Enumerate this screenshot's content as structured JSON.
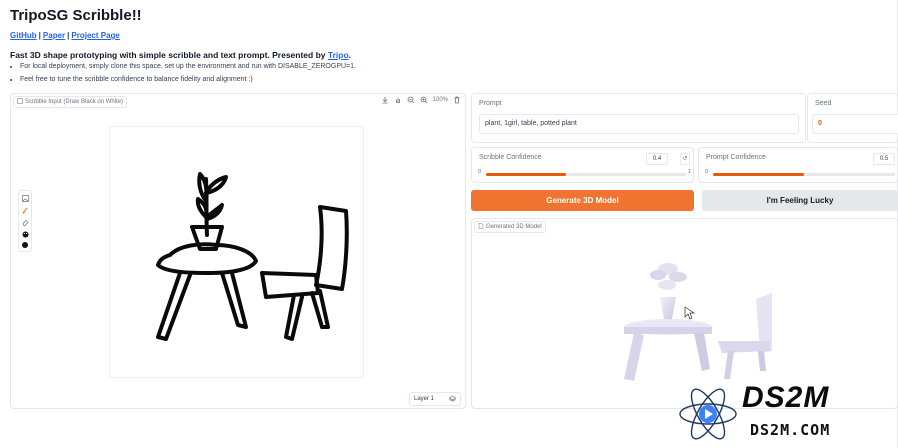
{
  "app": {
    "title": "TripoSG Scribble!!",
    "links": [
      {
        "label": "GitHub"
      },
      {
        "label": "Paper"
      },
      {
        "label": "Project Page"
      }
    ],
    "separator": "|",
    "subtitle_prefix": "Fast 3D shape prototyping with simple scribble and text prompt. Presented by ",
    "subtitle_link": "Tripo",
    "subtitle_suffix": ".",
    "notes": [
      "For local deployment, simply clone this space, set up the environment and run with DISABLE_ZEROGPU=1.",
      "Feel free to tune the scribble confidence to balance fidelity and alignment :)"
    ]
  },
  "scribble": {
    "label": "Scribble Input (Draw Black on White)",
    "zoom": "100%",
    "layer": "Layer 1",
    "icons": [
      "download-icon",
      "pan-icon",
      "zoom-out-icon",
      "zoom-in-icon",
      "trash-icon"
    ],
    "side_tools": [
      "image-icon",
      "brush-icon",
      "eraser-icon",
      "palette-icon",
      "color-black"
    ]
  },
  "prompt": {
    "label": "Prompt",
    "value": "plant, 1girl, table, potted plant"
  },
  "seed": {
    "label": "Seed",
    "value": "0"
  },
  "scribble_confidence": {
    "label": "Scribble Confidence",
    "value": "0.4",
    "min": "0",
    "max": "1",
    "fraction": 0.4
  },
  "prompt_confidence": {
    "label": "Prompt Confidence",
    "value": "0.5",
    "min": "0",
    "fraction": 0.5
  },
  "buttons": {
    "generate": "Generate 3D Model",
    "lucky": "I'm Feeling Lucky"
  },
  "model_output": {
    "label": "Generated 3D Model"
  },
  "watermark": {
    "big": "DS2M",
    "small": "DS2M.COM"
  },
  "colors": {
    "accent": "#f0732f",
    "link": "#2563eb"
  }
}
